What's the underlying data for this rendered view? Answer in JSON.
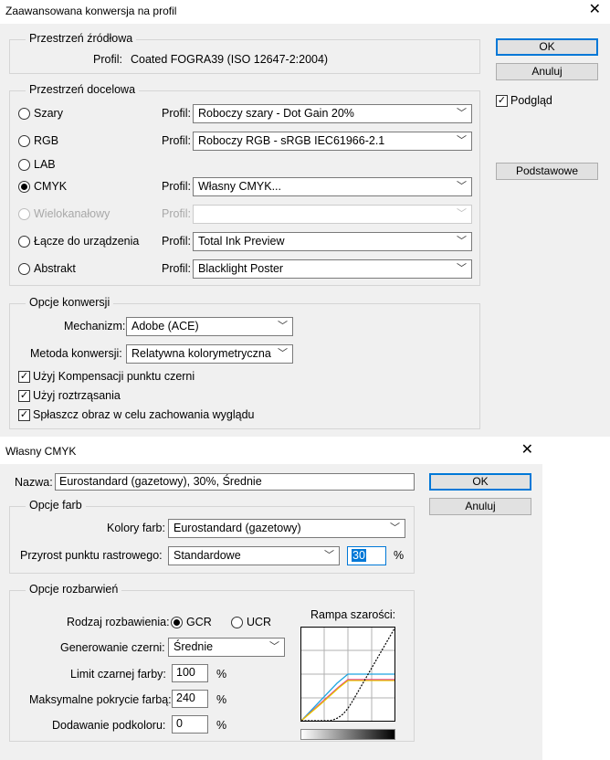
{
  "advanced": {
    "title": "Zaawansowana konwersja na profil",
    "ok_label": "OK",
    "cancel_label": "Anuluj",
    "preview_label": "Podgląd",
    "defaults_label": "Podstawowe",
    "source": {
      "legend": "Przestrzeń źródłowa",
      "profile_label": "Profil:",
      "profile_value": "Coated FOGRA39 (ISO 12647-2:2004)"
    },
    "target": {
      "legend": "Przestrzeń docelowa",
      "profile_label": "Profil:",
      "rows": [
        {
          "label": "Szary",
          "value": "Roboczy szary - Dot Gain 20%"
        },
        {
          "label": "RGB",
          "value": "Roboczy RGB - sRGB IEC61966-2.1"
        },
        {
          "label": "LAB",
          "value": ""
        },
        {
          "label": "CMYK",
          "value": "Własny CMYK..."
        },
        {
          "label": "Wielokanałowy",
          "value": ""
        },
        {
          "label": "Łącze do urządzenia",
          "value": "Total Ink Preview"
        },
        {
          "label": "Abstrakt",
          "value": "Blacklight Poster"
        }
      ]
    },
    "options": {
      "legend": "Opcje konwersji",
      "engine_label": "Mechanizm:",
      "engine_value": "Adobe (ACE)",
      "intent_label": "Metoda konwersji:",
      "intent_value": "Relatywna kolorymetryczna",
      "bpc_label": "Użyj Kompensacji punktu czerni",
      "dither_label": "Użyj roztrząsania",
      "flatten_label": "Spłaszcz obraz w celu zachowania wyglądu"
    }
  },
  "custom": {
    "title": "Własny CMYK",
    "name_label": "Nazwa:",
    "name_value": "Eurostandard (gazetowy), 30%,  Średnie",
    "ok_label": "OK",
    "cancel_label": "Anuluj",
    "ink": {
      "legend": "Opcje farb",
      "colors_label": "Kolory farb:",
      "colors_value": "Eurostandard (gazetowy)",
      "dotgain_label": "Przyrost punktu rastrowego:",
      "dotgain_value": "Standardowe",
      "dotgain_number": "30",
      "dotgain_unit": "%"
    },
    "separation": {
      "legend": "Opcje rozbarwień",
      "type_label": "Rodzaj rozbawienia:",
      "gcr_label": "GCR",
      "ucr_label": "UCR",
      "black_gen_label": "Generowanie czerni:",
      "black_gen_value": "Średnie",
      "black_limit_label": "Limit czarnej farby:",
      "black_limit_value": "100",
      "total_ink_label": "Maksymalne pokrycie farbą:",
      "total_ink_value": "240",
      "ucr_amount_label": "Dodawanie podkoloru:",
      "ucr_amount_value": "0",
      "percent": "%",
      "gray_ramp_label": "Rampa szarości:"
    }
  }
}
